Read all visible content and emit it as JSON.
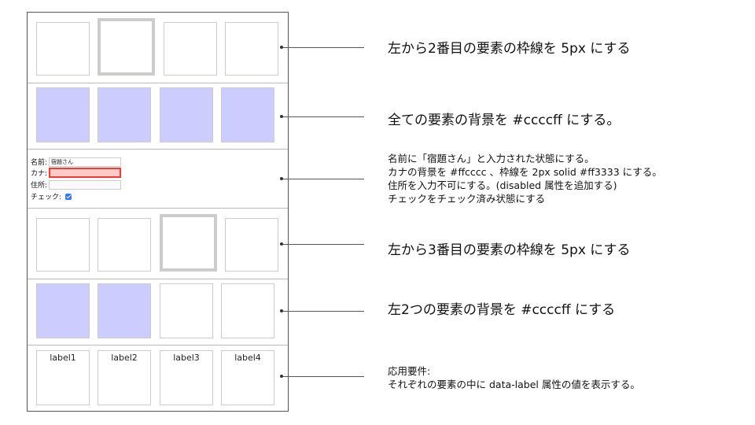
{
  "sections": {
    "s1": {
      "note": "左から2番目の要素の枠線を 5px にする"
    },
    "s2": {
      "note": "全ての要素の背景を #ccccff にする。"
    },
    "s3": {
      "form": {
        "name_label": "名前:",
        "name_value": "宿題さん",
        "kana_label": "カナ:",
        "kana_value": "",
        "address_label": "住所:",
        "address_value": "",
        "check_label": "チェック:"
      },
      "notes": [
        "名前に「宿題さん」と入力された状態にする。",
        "カナの背景を #ffcccc 、枠線を 2px solid #ff3333 にする。",
        "住所を入力不可にする。(disabled 属性を追加する)",
        "チェックをチェック済み状態にする"
      ]
    },
    "s4": {
      "note": "左から3番目の要素の枠線を 5px にする"
    },
    "s5": {
      "note": "左2つの要素の背景を #ccccff  にする"
    },
    "s6": {
      "labels": [
        "label1",
        "label2",
        "label3",
        "label4"
      ],
      "notes": [
        "応用要件:",
        "それぞれの要素の中に data-label 属性の値を表示する。"
      ]
    }
  },
  "colors": {
    "filled_bg": "#ccccff",
    "kana_bg": "#ffcccc",
    "kana_border": "#ff3333",
    "thick_border": "#cccccc"
  }
}
